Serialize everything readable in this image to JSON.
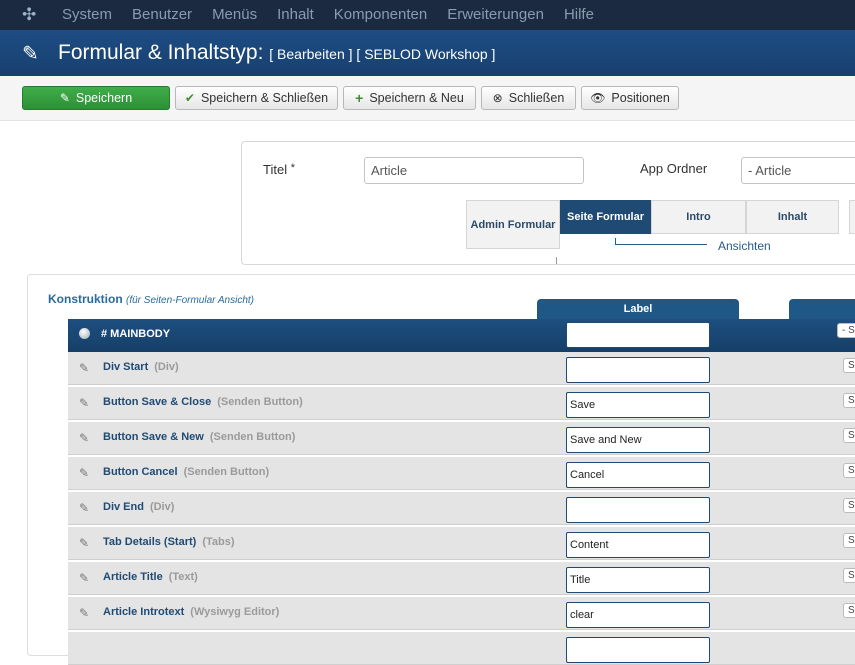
{
  "nav": {
    "items": [
      "System",
      "Benutzer",
      "Menüs",
      "Inhalt",
      "Komponenten",
      "Erweiterungen",
      "Hilfe"
    ]
  },
  "header": {
    "title": "Formular & Inhaltstyp:",
    "subtitle": "[ Bearbeiten ] [ SEBLOD Workshop ]"
  },
  "toolbar": {
    "save": "Speichern",
    "save_close": "Speichern & Schließen",
    "save_new": "Speichern & Neu",
    "close": "Schließen",
    "positions": "Positionen"
  },
  "form": {
    "title_label": "Titel",
    "required_mark": "*",
    "title_value": "Article",
    "app_folder_label": "App Ordner",
    "app_folder_value": "- Article",
    "views_label": "Ansichten",
    "tabs": [
      "Admin Formular",
      "Seite Formular",
      "Intro",
      "Inhalt"
    ],
    "active_tab": "Seite Formular"
  },
  "construction": {
    "title": "Konstruktion",
    "subtitle": "(für Seiten-Formular Ansicht)",
    "column_label": "Label",
    "main_row": "# MAINBODY",
    "select_hint": "- S",
    "rows": [
      {
        "name": "Div Start",
        "type": "(Div)",
        "value": ""
      },
      {
        "name": "Button Save & Close",
        "type": "(Senden Button)",
        "value": "Save"
      },
      {
        "name": "Button Save & New",
        "type": "(Senden Button)",
        "value": "Save and New"
      },
      {
        "name": "Button Cancel",
        "type": "(Senden Button)",
        "value": "Cancel"
      },
      {
        "name": "Div End",
        "type": "(Div)",
        "value": ""
      },
      {
        "name": "Tab Details (Start)",
        "type": "(Tabs)",
        "value": "Content"
      },
      {
        "name": "Article Title",
        "type": "(Text)",
        "value": "Title"
      },
      {
        "name": "Article Introtext",
        "type": "(Wysiwyg Editor)",
        "value": "clear"
      }
    ],
    "select_stub": "S"
  },
  "colors": {
    "nav_bg": "#1b2a40",
    "header_bg": "#1e4d84",
    "primary_green": "#3fae49",
    "accent_blue": "#1f4a74"
  }
}
